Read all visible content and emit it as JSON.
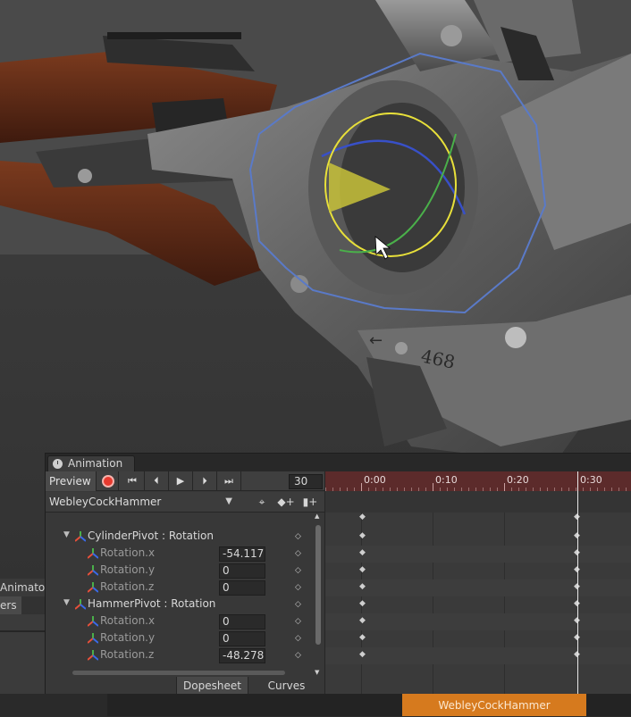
{
  "left_panel": {
    "tab_label": "Animator",
    "sub_tab_label": "ers"
  },
  "viewport": {
    "serial_number": "468",
    "arrow_glyph": "←"
  },
  "animation": {
    "tab_label": "Animation",
    "preview_label": "Preview",
    "playback_icons": [
      "record-icon",
      "first-key-icon",
      "prev-key-icon",
      "play-icon",
      "next-key-icon",
      "last-key-icon"
    ],
    "frame": "30",
    "clip_name": "WebleyCockHammer",
    "timeline_labels": [
      "0:00",
      "0:10",
      "0:20",
      "0:30"
    ],
    "properties": [
      {
        "label": "CylinderPivot : Rotation",
        "level": 0,
        "value": ""
      },
      {
        "label": "Rotation.x",
        "level": 1,
        "value": "-54.117"
      },
      {
        "label": "Rotation.y",
        "level": 1,
        "value": "0"
      },
      {
        "label": "Rotation.z",
        "level": 1,
        "value": "0"
      },
      {
        "label": "HammerPivot : Rotation",
        "level": 0,
        "value": ""
      },
      {
        "label": "Rotation.x",
        "level": 1,
        "value": "0"
      },
      {
        "label": "Rotation.y",
        "level": 1,
        "value": "0"
      },
      {
        "label": "Rotation.z",
        "level": 1,
        "value": "-48.278"
      }
    ],
    "bottom_tabs": [
      "Dopesheet",
      "Curves"
    ]
  },
  "clip_strip": {
    "label": "WebleyCockHammer"
  },
  "colors": {
    "record": "#e83a2f",
    "ruler": "#5c2b2b",
    "clip_block": "#d67a1e",
    "gizmo_yellow": "#e8e03a",
    "gizmo_blue": "#3850c8",
    "gizmo_green": "#4ab04a"
  }
}
